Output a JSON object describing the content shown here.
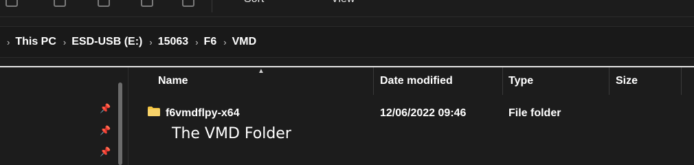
{
  "toolbar": {
    "sort_label": "Sort",
    "view_label": "View"
  },
  "breadcrumb": {
    "items": [
      "This PC",
      "ESD-USB (E:)",
      "15063",
      "F6",
      "VMD"
    ]
  },
  "columns": {
    "name": "Name",
    "date_modified": "Date modified",
    "type": "Type",
    "size": "Size"
  },
  "files": [
    {
      "name": "f6vmdflpy-x64",
      "date_modified": "12/06/2022 09:46",
      "type": "File folder",
      "size": "",
      "icon": "folder-icon"
    }
  ],
  "annotation": "The VMD Folder",
  "colors": {
    "background": "#1c1c1c",
    "folder": "#f4c542",
    "text": "#ffffff"
  }
}
